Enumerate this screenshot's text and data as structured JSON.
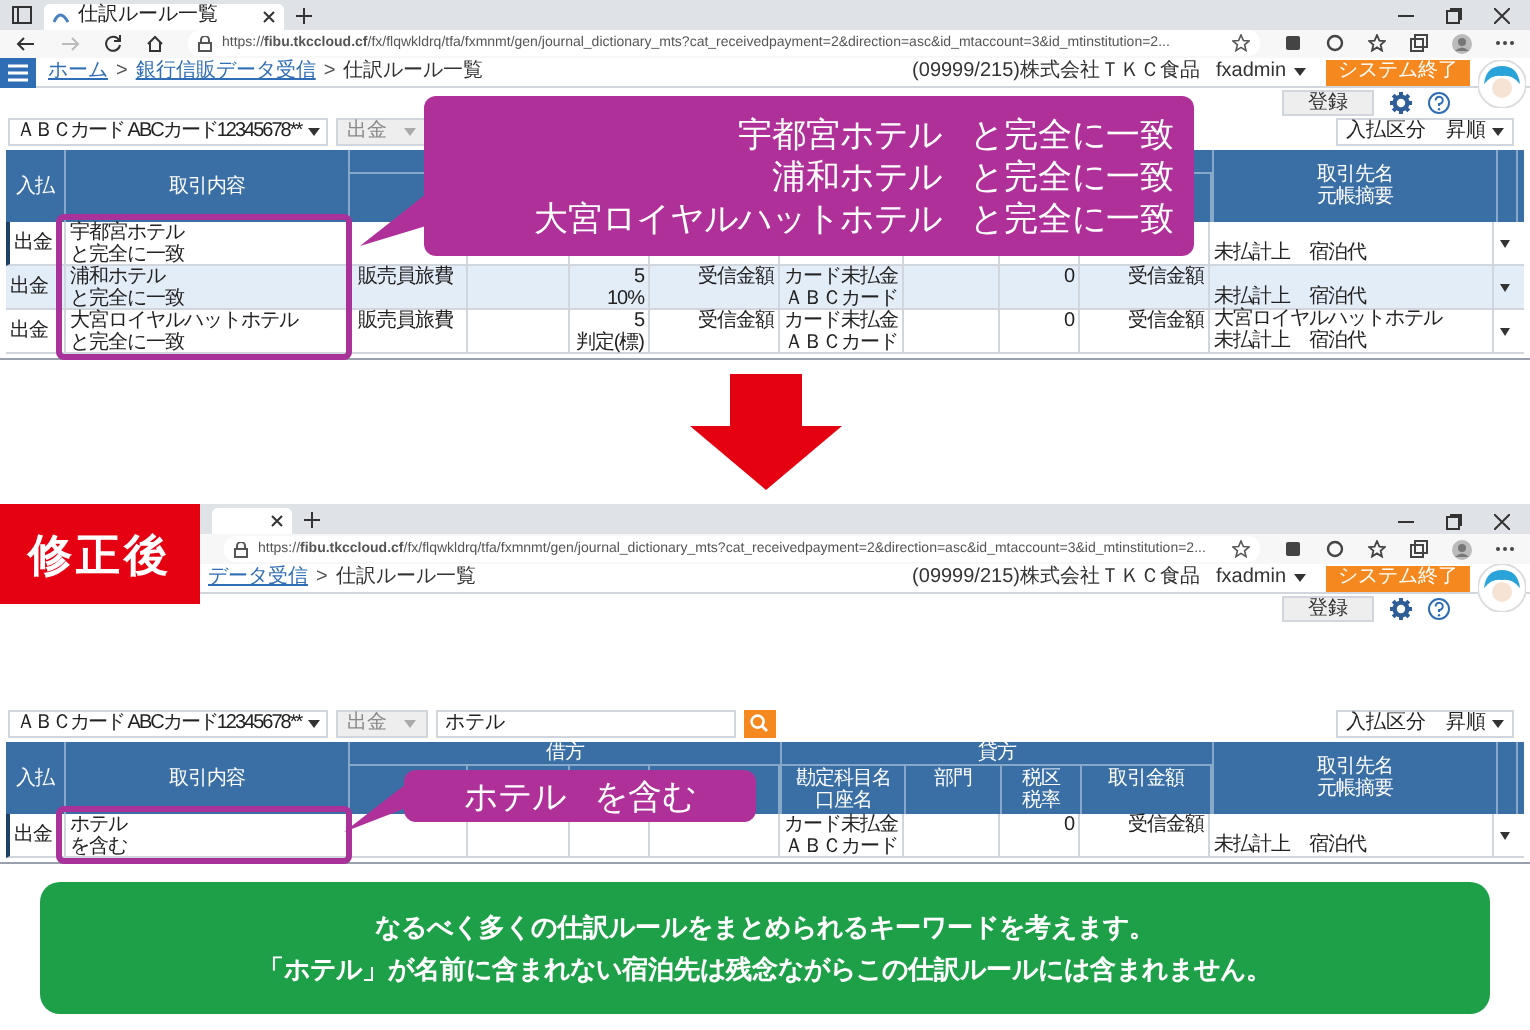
{
  "screens": [
    {
      "tab_title": "仕訳ルール一覧",
      "url": "https://**fibu.tkccloud.cf**/fx/flqwkldrq/tfa/fxmnmt/gen/journal_dictionary_mts?cat_receivedpayment=2&direction=asc&id_mtaccount=3&id_mtinstitution=2...",
      "breadcrumb": [
        {
          "label": "ホーム",
          "link": true,
          "separator": ">"
        },
        {
          "label": "銀行信販データ受信",
          "link": true,
          "separator": ">"
        },
        {
          "label": "仕訳ルール一覧",
          "link": false
        }
      ],
      "company": "(09999/215)株式会社ＴＫＣ食品",
      "user": "fxadmin",
      "exit_button": "システム終了",
      "register_button": "登録",
      "account_select": "ＡＢＣカード ABCカード12345678**",
      "direction_select": {
        "value": "出金",
        "disabled": true
      },
      "sort_select": "入払区分　昇順",
      "header": {
        "direction": "入払",
        "content": "取引内容",
        "partner": [
          "取引先名",
          "元帳摘要"
        ]
      },
      "rows": [
        {
          "selected": true,
          "direction": "出金",
          "content": [
            "宇都宮ホテル",
            "と完全に一致"
          ],
          "partner": {
            "memo": "未払計上　宿泊代"
          }
        },
        {
          "selected": false,
          "direction": "出金",
          "content": [
            "浦和ホテル",
            "と完全に一致"
          ],
          "debit": {
            "account": [
              "販売員旅費"
            ],
            "tax": [
              "5",
              "10%"
            ],
            "amount": "受信金額"
          },
          "credit": {
            "account": [
              "カード未払金",
              "ＡＢＣカード"
            ],
            "tax": [
              "0"
            ],
            "amount": "受信金額"
          },
          "partner": {
            "memo": "未払計上　宿泊代"
          }
        },
        {
          "selected": false,
          "direction": "出金",
          "content": [
            "大宮ロイヤルハットホテル",
            "と完全に一致"
          ],
          "debit": {
            "account": [
              "販売員旅費"
            ],
            "tax": [
              "5",
              "判定(標)"
            ],
            "amount": "受信金額"
          },
          "credit": {
            "account": [
              "カード未払金",
              "ＡＢＣカード"
            ],
            "tax": [
              "0"
            ],
            "amount": "受信金額"
          },
          "partner": {
            "name": "大宮ロイヤルハットホテル",
            "memo": "未払計上　宿泊代"
          }
        }
      ],
      "callout": {
        "lines": [
          {
            "term": "宇都宮ホテル",
            "rule": "と完全に一致"
          },
          {
            "term": "浦和ホテル",
            "rule": "と完全に一致"
          },
          {
            "term": "大宮ロイヤルハットホテル",
            "rule": "と完全に一致"
          }
        ]
      }
    },
    {
      "badge": "修正後",
      "url": "https://**fibu.tkccloud.cf**/fx/flqwkldrq/tfa/fxmnmt/gen/journal_dictionary_mts?cat_receivedpayment=2&direction=asc&id_mtaccount=3&id_mtinstitution=2...",
      "breadcrumb": [
        {
          "label": "データ受信",
          "link": true,
          "separator": ">"
        },
        {
          "label": "仕訳ルール一覧",
          "link": false
        }
      ],
      "company": "(09999/215)株式会社ＴＫＣ食品",
      "user": "fxadmin",
      "exit_button": "システム終了",
      "register_button": "登録",
      "account_select": "ＡＢＣカード ABCカード12345678**",
      "direction_select": {
        "value": "出金",
        "disabled": true
      },
      "search": {
        "value": "ホテル"
      },
      "sort_select": "入払区分　昇順",
      "header": {
        "direction": "入払",
        "content": "取引内容",
        "debit_group": "借方",
        "credit_group": "貸方",
        "credit": [
          [
            "勘定科目名",
            "口座名"
          ],
          [
            "部門"
          ],
          [
            "税区",
            "税率"
          ],
          [
            "取引金額"
          ]
        ],
        "partner": [
          "取引先名",
          "元帳摘要"
        ]
      },
      "rows": [
        {
          "selected": true,
          "direction": "出金",
          "content": [
            "ホテル",
            "を含む"
          ],
          "credit": {
            "account": [
              "カード未払金",
              "ＡＢＣカード"
            ],
            "tax": [
              "0"
            ],
            "amount": "受信金額"
          },
          "partner": {
            "memo": "未払計上　宿泊代"
          }
        }
      ],
      "callout": {
        "lines": [
          {
            "term": "ホテル",
            "rule": "を含む"
          }
        ]
      }
    }
  ],
  "caption": [
    "なるべく多くの仕訳ルールをまとめられるキーワードを考えます。",
    "「ホテル」が名前に含まれない宿泊先は残念ながらこの仕訳ルールには含まれません。"
  ]
}
